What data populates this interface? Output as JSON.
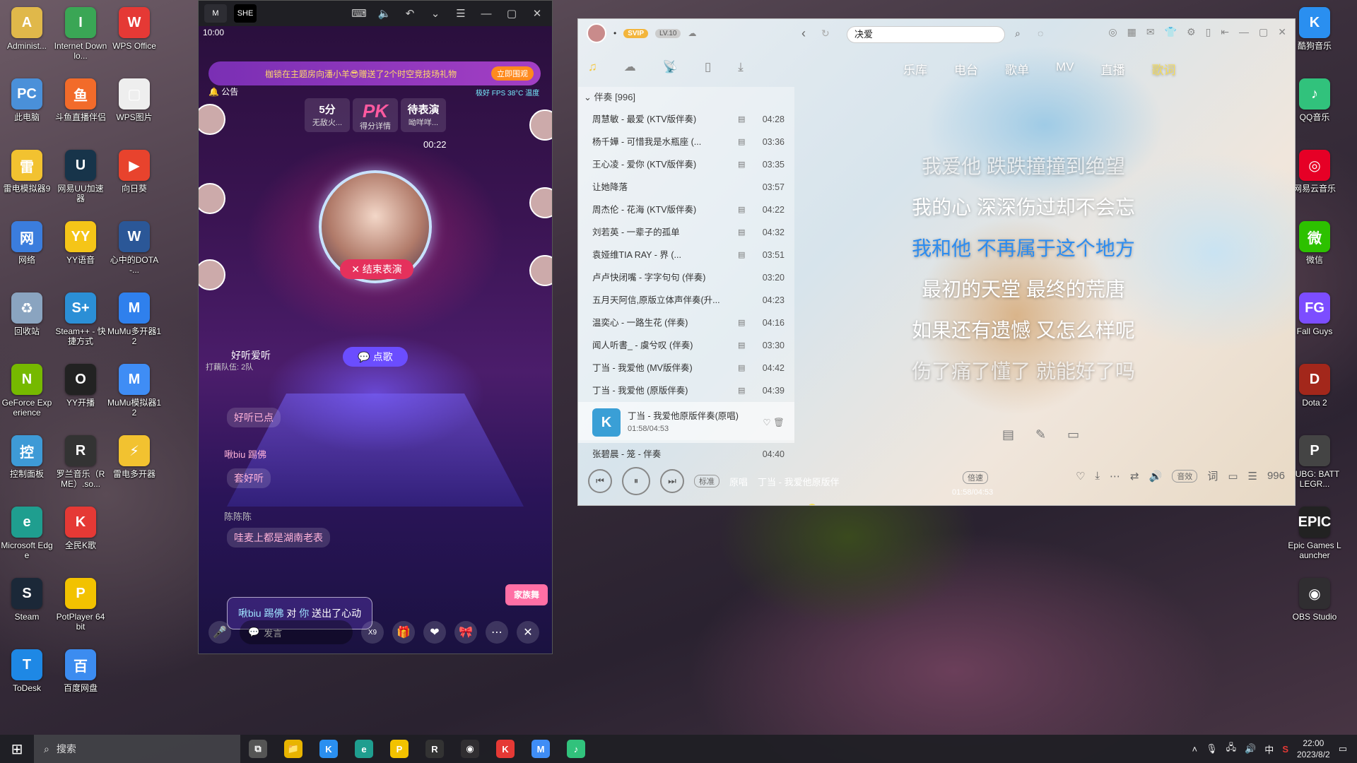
{
  "desktop": {
    "col1": [
      {
        "label": "Administ...",
        "icon": "folder-user-icon",
        "color": "#e0b84a",
        "glyph": "A"
      },
      {
        "label": "此电脑",
        "icon": "computer-icon",
        "color": "#4a90d9",
        "glyph": "PC"
      },
      {
        "label": "雷电模拟器9",
        "icon": "ldplayer-icon",
        "color": "#f2c230",
        "glyph": "雷"
      },
      {
        "label": "网络",
        "icon": "network-icon",
        "color": "#3b7ddd",
        "glyph": "网"
      },
      {
        "label": "回收站",
        "icon": "recycle-bin-icon",
        "color": "#8aa4c0",
        "glyph": "♻"
      },
      {
        "label": "GeForce Experience",
        "icon": "nvidia-icon",
        "color": "#76b900",
        "glyph": "N"
      },
      {
        "label": "控制面板",
        "icon": "control-panel-icon",
        "color": "#3e9ad6",
        "glyph": "控"
      },
      {
        "label": "Microsoft Edge",
        "icon": "edge-icon",
        "color": "#1f9e8f",
        "glyph": "e"
      },
      {
        "label": "Steam",
        "icon": "steam-icon",
        "color": "#1b2838",
        "glyph": "S"
      },
      {
        "label": "ToDesk",
        "icon": "todesk-icon",
        "color": "#1e88e5",
        "glyph": "T"
      }
    ],
    "col2": [
      {
        "label": "Internet Downlo...",
        "icon": "idm-icon",
        "color": "#3aa655",
        "glyph": "I"
      },
      {
        "label": "斗鱼直播伴侣",
        "icon": "douyu-icon",
        "color": "#f26b2a",
        "glyph": "鱼"
      },
      {
        "label": "网易UU加速器",
        "icon": "uu-icon",
        "color": "#17344a",
        "glyph": "U"
      },
      {
        "label": "YY语音",
        "icon": "yy-icon",
        "color": "#f5c518",
        "glyph": "YY"
      },
      {
        "label": "Steam++ - 快捷方式",
        "icon": "steampp-icon",
        "color": "#2b8fd6",
        "glyph": "S+"
      },
      {
        "label": "YY开播",
        "icon": "yy-live-icon",
        "color": "#222",
        "glyph": "O"
      },
      {
        "label": "罗兰音乐（RME）.so...",
        "icon": "rme-icon",
        "color": "#333",
        "glyph": "R"
      },
      {
        "label": "全民K歌",
        "icon": "kge-icon",
        "color": "#e53935",
        "glyph": "K"
      },
      {
        "label": "PotPlayer 64 bit",
        "icon": "potplayer-icon",
        "color": "#f2c200",
        "glyph": "P"
      },
      {
        "label": "百度网盘",
        "icon": "baidu-pan-icon",
        "color": "#3c8cf0",
        "glyph": "百"
      }
    ],
    "col3": [
      {
        "label": "WPS Office",
        "icon": "wps-icon",
        "color": "#e53935",
        "glyph": "W"
      },
      {
        "label": "WPS图片",
        "icon": "wps-image-icon",
        "color": "#eeeeee",
        "glyph": "▢"
      },
      {
        "label": "向日葵",
        "icon": "sunflower-icon",
        "color": "#e8432d",
        "glyph": "▶"
      },
      {
        "label": "心中的DOTA-...",
        "icon": "word-doc-icon",
        "color": "#2b5797",
        "glyph": "W"
      },
      {
        "label": "MuMu多开器12",
        "icon": "mumu-multi-icon",
        "color": "#2f80ed",
        "glyph": "M"
      },
      {
        "label": "MuMu模拟器12",
        "icon": "mumu-icon",
        "color": "#3f8df5",
        "glyph": "M"
      },
      {
        "label": "雷电多开器",
        "icon": "ld-multi-icon",
        "color": "#f2c230",
        "glyph": "⚡"
      }
    ],
    "right": [
      {
        "label": "酷狗音乐",
        "icon": "kugou-icon",
        "color": "#2a8ff0",
        "glyph": "K"
      },
      {
        "label": "QQ音乐",
        "icon": "qqmusic-icon",
        "color": "#31c27c",
        "glyph": "♪"
      },
      {
        "label": "网易云音乐",
        "icon": "netease-music-icon",
        "color": "#e60026",
        "glyph": "◎"
      },
      {
        "label": "微信",
        "icon": "wechat-icon",
        "color": "#2dc100",
        "glyph": "微"
      },
      {
        "label": "Fall Guys",
        "icon": "fallguys-icon",
        "color": "#7c4dff",
        "glyph": "FG"
      },
      {
        "label": "Dota 2",
        "icon": "dota-icon",
        "color": "#a3271b",
        "glyph": "D"
      },
      {
        "label": "PUBG: BATTLEGR...",
        "icon": "pubg-icon",
        "color": "#444",
        "glyph": "P"
      },
      {
        "label": "Epic Games Launcher",
        "icon": "epic-icon",
        "color": "#222",
        "glyph": "EPIC"
      },
      {
        "label": "OBS Studio",
        "icon": "obs-icon",
        "color": "#302e31",
        "glyph": "◉"
      }
    ]
  },
  "phone": {
    "tab1": "M",
    "tab2": "SHE",
    "time": "10:00",
    "banner": "枷锁在主题房向潘小羊😎赠送了2个时空竞技场礼物",
    "banner_btn": "立即围观",
    "notice": "🔔 公告",
    "net_status": "极好",
    "fps": "FPS",
    "temp": "38°C",
    "temp_label": "温度",
    "pk_left_score": "5分",
    "pk_left_sub": "无敌火...",
    "pk_label": "PK",
    "pk_sub": "得分详情",
    "pk_right_title": "待表演",
    "pk_right_sub": "呦咩咩...",
    "countdown": "00:22",
    "end_show": "✕ 结束表演",
    "order_song": "💬 点歌",
    "song_title": "好听爱听",
    "queue": "打藕队伍: 2队",
    "chat1": "好听已点",
    "chat2_name": "啾biu 踢佛",
    "chat2": "套好听",
    "chat3_name": "陈陈陈",
    "chat3": "哇麦上都是湖南老表",
    "gift_name": "啾biu 踢佛",
    "gift_mid": " 对 ",
    "gift_target": "你",
    "gift_tail": " 送出了心动",
    "input_placeholder": "发言",
    "count_x9": "X9",
    "family": "家族舞"
  },
  "music": {
    "svip": "SVIP",
    "level": "LV.10",
    "search_value": "决爱",
    "nav": [
      "乐库",
      "电台",
      "歌单",
      "MV",
      "直播",
      "歌词"
    ],
    "list_header": "伴奏 [996]",
    "songs": [
      {
        "title": "周慧敏 - 最爱 (KTV版伴奏)",
        "dur": "04:28",
        "mv": "▤"
      },
      {
        "title": "杨千嬅 - 可惜我是水瓶座 (...",
        "dur": "03:36",
        "mv": "▤"
      },
      {
        "title": "王心凌 - 爱你 (KTV版伴奏)",
        "dur": "03:35",
        "mv": "▤"
      },
      {
        "title": "让她降落",
        "dur": "03:57",
        "mv": ""
      },
      {
        "title": "周杰伦 - 花海 (KTV版伴奏)",
        "dur": "04:22",
        "mv": "▤"
      },
      {
        "title": "刘若英 - 一辈子的孤单",
        "dur": "04:32",
        "mv": "▤"
      },
      {
        "title": "袁娅维TIA RAY - 界 (...",
        "dur": "03:51",
        "mv": "▤"
      },
      {
        "title": "卢卢快闭嘴 - 字字句句 (伴奏)",
        "dur": "03:20",
        "mv": ""
      },
      {
        "title": "五月天阿信,原版立体声伴奏(升...",
        "dur": "04:23",
        "mv": ""
      },
      {
        "title": "温奕心 - 一路生花 (伴奏)",
        "dur": "04:16",
        "mv": "▤"
      },
      {
        "title": "闻人听書_ - 虞兮叹 (伴奏)",
        "dur": "03:30",
        "mv": "▤"
      },
      {
        "title": "丁当 - 我爱他 (MV版伴奏)",
        "dur": "04:42",
        "mv": "▤"
      },
      {
        "title": "丁当 - 我爱他 (原版伴奏)",
        "dur": "04:39",
        "mv": "▤"
      }
    ],
    "current": {
      "title": "丁当 - 我爱他原版伴奏(原唱)",
      "time": "01:58/04:53"
    },
    "after": {
      "title": "张碧晨 - 笼 - 伴奏",
      "dur": "04:40"
    },
    "lyrics": [
      "我爱他 跌跌撞撞到绝望",
      "我的心 深深伤过却不会忘",
      "我和他 不再属于这个地方",
      "最初的天堂 最终的荒唐",
      "如果还有遗憾 又怎么样呢",
      "伤了痛了懂了 就能好了吗"
    ],
    "player_mode": "标准",
    "player_orig": "原唱",
    "player_song": "丁当 - 我爱他原版伴",
    "player_time": "01:58/04:53",
    "speed": "倍速",
    "sound": "音效",
    "ci": "词",
    "queue_count": "996"
  },
  "taskbar": {
    "search": "搜索",
    "time": "22:00",
    "date": "2023/8/2",
    "ime": "中",
    "apps": [
      {
        "icon": "task-view-icon",
        "color": "#555",
        "glyph": "⧉"
      },
      {
        "icon": "file-explorer-icon",
        "color": "#e8b400",
        "glyph": "📁"
      },
      {
        "icon": "kugou-task-icon",
        "color": "#2a8ff0",
        "glyph": "K"
      },
      {
        "icon": "edge-task-icon",
        "color": "#1f9e8f",
        "glyph": "e"
      },
      {
        "icon": "potplayer-task-icon",
        "color": "#f2c200",
        "glyph": "P"
      },
      {
        "icon": "rme-task-icon",
        "color": "#333",
        "glyph": "R"
      },
      {
        "icon": "obs-task-icon",
        "color": "#302e31",
        "glyph": "◉"
      },
      {
        "icon": "kge-task-icon",
        "color": "#e53935",
        "glyph": "K"
      },
      {
        "icon": "mumu-task-icon",
        "color": "#3f8df5",
        "glyph": "M"
      },
      {
        "icon": "qqmusic-task-icon",
        "color": "#31c27c",
        "glyph": "♪"
      }
    ]
  }
}
